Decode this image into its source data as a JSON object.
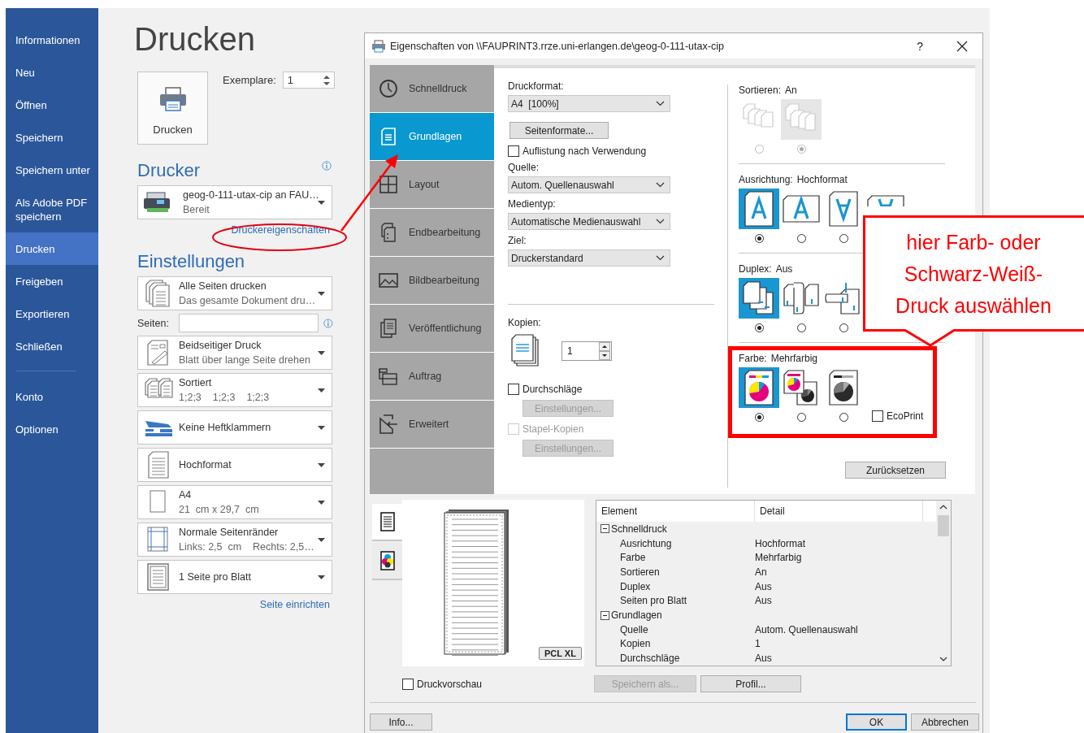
{
  "sidebar": {
    "items": [
      {
        "label": "Informationen",
        "selected": false
      },
      {
        "label": "Neu",
        "selected": false
      },
      {
        "label": "Öffnen",
        "selected": false
      },
      {
        "label": "Speichern",
        "selected": false
      },
      {
        "label": "Speichern unter",
        "selected": false
      },
      {
        "label": "Als Adobe PDF speichern",
        "selected": false
      },
      {
        "label": "Drucken",
        "selected": true
      },
      {
        "label": "Freigeben",
        "selected": false
      },
      {
        "label": "Exportieren",
        "selected": false
      },
      {
        "label": "Schließen",
        "selected": false
      }
    ],
    "footer_items": [
      {
        "label": "Konto",
        "selected": false
      },
      {
        "label": "Optionen",
        "selected": false
      }
    ]
  },
  "print_panel": {
    "title": "Drucken",
    "print_button": "Drucken",
    "copies_label": "Exemplare:",
    "copies_value": "1",
    "printer_heading": "Drucker",
    "printer": {
      "name": "geog-0-111-utax-cip an FAU…",
      "status": "Bereit"
    },
    "properties_link": "Druckereigenschaften",
    "settings_heading": "Einstellungen",
    "settings": [
      {
        "kind": "pages",
        "title": "Alle Seiten drucken",
        "subtitle": "Das gesamte Dokument dru…"
      },
      {
        "kind": "range",
        "label": "Seiten:"
      },
      {
        "kind": "duplex",
        "title": "Beidseitiger Druck",
        "subtitle": "Blatt über lange Seite drehen"
      },
      {
        "kind": "collate",
        "title": "Sortiert",
        "subtitle": "1;2;3    1;2;3    1;2;3"
      },
      {
        "kind": "staple",
        "title": "Keine Heftklammern"
      },
      {
        "kind": "orientation",
        "title": "Hochformat"
      },
      {
        "kind": "paper",
        "title": "A4",
        "subtitle": "21  cm x 29,7  cm"
      },
      {
        "kind": "margins",
        "title": "Normale Seitenränder",
        "subtitle": "Links: 2,5  cm    Rechts: 2,5…"
      },
      {
        "kind": "per_sheet",
        "title": "1 Seite pro Blatt"
      }
    ],
    "page_setup_link": "Seite einrichten"
  },
  "dialog": {
    "title": "Eigenschaften von \\\\FAUPRINT3.rrze.uni-erlangen.de\\geog-0-111-utax-cip",
    "help": "?",
    "tabs": [
      {
        "kind": "clock",
        "label": "Schnelldruck",
        "selected": false
      },
      {
        "kind": "document",
        "label": "Grundlagen",
        "selected": true
      },
      {
        "kind": "layout",
        "label": "Layout",
        "selected": false
      },
      {
        "kind": "finishing",
        "label": "Endbearbeitung",
        "selected": false
      },
      {
        "kind": "image",
        "label": "Bildbearbeitung",
        "selected": false
      },
      {
        "kind": "publish",
        "label": "Veröffentlichung",
        "selected": false
      },
      {
        "kind": "job",
        "label": "Auftrag",
        "selected": false
      },
      {
        "kind": "advanced",
        "label": "Erweitert",
        "selected": false
      }
    ],
    "basics": [
      {
        "kind": "label",
        "text": "Druckformat:"
      },
      {
        "kind": "select",
        "value": "A4  [100%]"
      },
      {
        "kind": "button",
        "text": "Seitenformate...",
        "disabled": false
      },
      {
        "kind": "checkbox",
        "label": "Auflistung nach Verwendung",
        "checked": false,
        "disabled": false
      },
      {
        "kind": "label",
        "text": "Quelle:"
      },
      {
        "kind": "select",
        "value": "Autom. Quellenauswahl"
      },
      {
        "kind": "label",
        "text": "Medientyp:"
      },
      {
        "kind": "select",
        "value": "Automatische Medienauswahl"
      },
      {
        "kind": "label",
        "text": "Ziel:"
      },
      {
        "kind": "select",
        "value": "Druckerstandard"
      }
    ],
    "copies": {
      "label": "Kopien:",
      "value": "1",
      "controls": [
        {
          "kind": "checkbox",
          "label": "Durchschläge",
          "checked": false,
          "disabled": false
        },
        {
          "kind": "button",
          "text": "Einstellungen...",
          "disabled": true
        },
        {
          "kind": "checkbox",
          "label": "Stapel-Kopien",
          "checked": false,
          "disabled": true
        },
        {
          "kind": "button",
          "text": "Einstellungen...",
          "disabled": true
        }
      ]
    },
    "sections": [
      {
        "label": "Sortieren:",
        "value": "An",
        "disabled": true,
        "options": [
          {
            "kind": "uncollated",
            "selected": false
          },
          {
            "kind": "collated",
            "selected": true
          }
        ]
      },
      {
        "label": "Ausrichtung:",
        "value": "Hochformat",
        "disabled": false,
        "options": [
          {
            "kind": "portrait",
            "selected": true
          },
          {
            "kind": "landscape",
            "selected": false
          },
          {
            "kind": "portrait_rotated",
            "selected": false
          },
          {
            "kind": "landscape_rotated"
          }
        ]
      },
      {
        "label": "Duplex:",
        "value": "Aus",
        "disabled": false,
        "options": [
          {
            "kind": "none",
            "selected": true
          },
          {
            "kind": "long",
            "selected": false
          },
          {
            "kind": "short",
            "selected": false
          }
        ]
      },
      {
        "label": "Farbe:",
        "value": "Mehrfarbig",
        "disabled": false,
        "options": [
          {
            "kind": "color",
            "selected": true
          },
          {
            "kind": "auto",
            "selected": false
          },
          {
            "kind": "mono",
            "selected": false
          }
        ],
        "ecoprint": {
          "label": "EcoPrint",
          "checked": false
        }
      }
    ],
    "reset_button": "Zurücksetzen",
    "preview": {
      "tabs": [
        {
          "kind": "page",
          "selected": true
        },
        {
          "kind": "color",
          "selected": false
        }
      ],
      "badge": "PCL XL",
      "checkbox": {
        "label": "Druckvorschau",
        "checked": false
      }
    },
    "summary": {
      "columns": [
        "Element",
        "Detail"
      ],
      "groups": [
        {
          "label": "Schnelldruck",
          "expanded": true,
          "rows": [
            [
              "Ausrichtung",
              "Hochformat"
            ],
            [
              "Farbe",
              "Mehrfarbig"
            ],
            [
              "Sortieren",
              "An"
            ],
            [
              "Duplex",
              "Aus"
            ],
            [
              "Seiten pro Blatt",
              "Aus"
            ]
          ]
        },
        {
          "label": "Grundlagen",
          "expanded": true,
          "rows": [
            [
              "Quelle",
              "Autom. Quellenauswahl"
            ],
            [
              "Kopien",
              "1"
            ],
            [
              "Durchschläge",
              "Aus"
            ]
          ]
        }
      ]
    },
    "buttons": [
      {
        "label": "Speichern als...",
        "disabled": true
      },
      {
        "label": "Profil...",
        "disabled": false
      }
    ],
    "footer": [
      {
        "label": "Info...",
        "default": false
      },
      {
        "label": "OK",
        "default": true
      },
      {
        "label": "Abbrechen",
        "default": false
      }
    ]
  },
  "annotation": {
    "callout_lines": [
      "hier Farb- oder",
      "Schwarz-Weiß-",
      "Druck auswählen"
    ]
  }
}
